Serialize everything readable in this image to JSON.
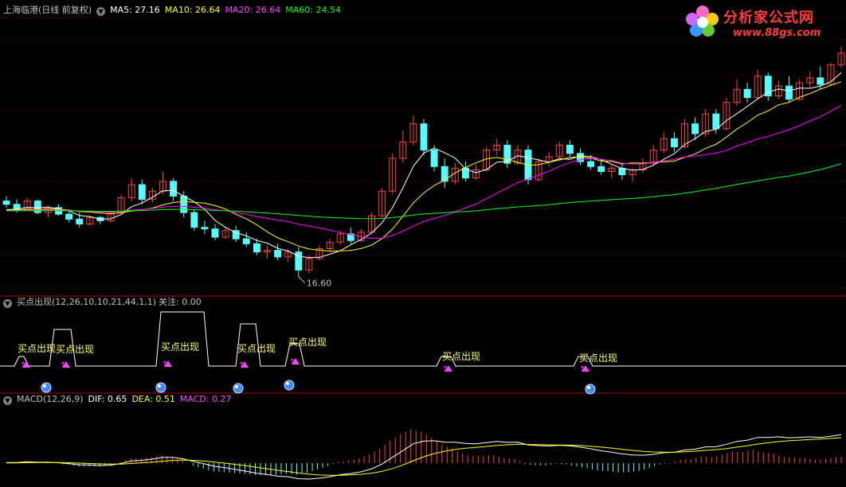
{
  "header": {
    "title": "上海临港(日线 前复权)",
    "ma5_label": "MA5: 27.16",
    "ma10_label": "MA10: 26.64",
    "ma20_label": "MA20: 26.64",
    "ma60_label": "MA60: 24.54"
  },
  "indicator_header": {
    "title": "买点出现(12,26,10,10,21,44,1,1)",
    "attention_label": "关注: 0.00"
  },
  "macd_header": {
    "title": "MACD(12,26,9)",
    "dif_label": "DIF: 0.65",
    "dea_label": "DEA: 0.51",
    "macd_label": "MACD: 0.27"
  },
  "logo": {
    "name": "分析家公式网",
    "url": "www.88gs.com"
  },
  "colors": {
    "up": "#ff4040",
    "down": "#54ffff",
    "ma5": "#ffffff",
    "ma10": "#ffff00",
    "ma20": "#ff00ff",
    "ma60": "#00ff00",
    "grid": "#80001a",
    "signal": "#ffff66"
  },
  "chart_data": [
    {
      "type": "candlestick",
      "title": "上海临港(日线 前复权)",
      "low_annotation": "16.60",
      "series": [
        {
          "name": "MA5",
          "value": 27.16
        },
        {
          "name": "MA10",
          "value": 26.64
        },
        {
          "name": "MA20",
          "value": 26.64
        },
        {
          "name": "MA60",
          "value": 24.54
        }
      ],
      "candles": [
        [
          21.2,
          21.5,
          20.8,
          21.0
        ],
        [
          21.0,
          21.3,
          20.5,
          20.7
        ],
        [
          20.7,
          21.4,
          20.6,
          21.2
        ],
        [
          21.2,
          21.3,
          20.4,
          20.5
        ],
        [
          20.5,
          20.9,
          20.2,
          20.8
        ],
        [
          20.8,
          21.0,
          20.3,
          20.4
        ],
        [
          20.4,
          20.6,
          19.9,
          20.1
        ],
        [
          20.1,
          20.5,
          19.6,
          19.8
        ],
        [
          19.8,
          20.3,
          19.7,
          20.2
        ],
        [
          20.2,
          20.3,
          19.8,
          20.0
        ],
        [
          20.0,
          20.6,
          19.9,
          20.5
        ],
        [
          20.5,
          21.6,
          20.4,
          21.4
        ],
        [
          21.4,
          22.6,
          21.2,
          22.2
        ],
        [
          22.2,
          22.5,
          21.0,
          21.3
        ],
        [
          21.3,
          22.0,
          21.1,
          21.8
        ],
        [
          21.8,
          23.0,
          21.6,
          22.4
        ],
        [
          22.4,
          22.6,
          21.2,
          21.5
        ],
        [
          21.5,
          21.8,
          20.2,
          20.5
        ],
        [
          20.5,
          20.7,
          19.4,
          19.6
        ],
        [
          19.6,
          20.0,
          19.2,
          19.5
        ],
        [
          19.5,
          19.8,
          18.8,
          19.0
        ],
        [
          19.0,
          19.6,
          18.9,
          19.4
        ],
        [
          19.4,
          19.7,
          18.7,
          18.9
        ],
        [
          18.9,
          19.3,
          18.4,
          18.6
        ],
        [
          18.6,
          18.9,
          17.9,
          18.1
        ],
        [
          18.1,
          18.5,
          17.7,
          18.2
        ],
        [
          18.2,
          18.6,
          17.6,
          17.8
        ],
        [
          17.8,
          18.3,
          17.5,
          18.1
        ],
        [
          18.1,
          18.4,
          16.6,
          17.0
        ],
        [
          17.0,
          17.9,
          16.8,
          17.7
        ],
        [
          17.7,
          18.5,
          17.6,
          18.3
        ],
        [
          18.3,
          18.9,
          18.1,
          18.7
        ],
        [
          18.7,
          19.4,
          18.5,
          19.2
        ],
        [
          19.2,
          19.6,
          18.6,
          18.8
        ],
        [
          18.8,
          19.5,
          18.7,
          19.3
        ],
        [
          19.3,
          20.5,
          19.2,
          20.3
        ],
        [
          20.3,
          22.0,
          20.2,
          21.8
        ],
        [
          21.8,
          24.1,
          21.6,
          23.8
        ],
        [
          23.8,
          25.5,
          23.5,
          24.8
        ],
        [
          24.8,
          26.4,
          24.6,
          25.9
        ],
        [
          25.9,
          26.2,
          24.0,
          24.3
        ],
        [
          24.3,
          24.6,
          23.0,
          23.3
        ],
        [
          23.3,
          23.8,
          22.0,
          22.4
        ],
        [
          22.4,
          23.5,
          22.2,
          23.2
        ],
        [
          23.2,
          23.6,
          22.4,
          22.6
        ],
        [
          22.6,
          23.4,
          22.5,
          23.1
        ],
        [
          23.1,
          24.5,
          23.0,
          24.3
        ],
        [
          24.3,
          25.0,
          24.0,
          24.6
        ],
        [
          24.6,
          24.9,
          23.2,
          23.5
        ],
        [
          23.5,
          24.6,
          23.4,
          24.3
        ],
        [
          24.3,
          24.6,
          22.2,
          22.5
        ],
        [
          22.5,
          23.8,
          22.4,
          23.6
        ],
        [
          23.6,
          24.2,
          23.3,
          23.9
        ],
        [
          23.9,
          24.8,
          23.7,
          24.6
        ],
        [
          24.6,
          24.9,
          23.9,
          24.1
        ],
        [
          24.1,
          24.4,
          23.4,
          23.6
        ],
        [
          23.6,
          24.0,
          23.1,
          23.3
        ],
        [
          23.3,
          23.7,
          22.8,
          23.0
        ],
        [
          23.0,
          23.4,
          22.6,
          23.2
        ],
        [
          23.2,
          23.5,
          22.5,
          22.8
        ],
        [
          22.8,
          23.2,
          22.4,
          23.1
        ],
        [
          23.1,
          23.8,
          22.9,
          23.5
        ],
        [
          23.5,
          24.6,
          23.4,
          24.3
        ],
        [
          24.3,
          25.4,
          24.1,
          25.0
        ],
        [
          25.0,
          25.4,
          24.2,
          24.5
        ],
        [
          24.5,
          26.2,
          24.4,
          25.9
        ],
        [
          25.9,
          26.3,
          24.9,
          25.3
        ],
        [
          25.3,
          26.8,
          25.1,
          26.5
        ],
        [
          26.5,
          26.8,
          25.3,
          25.6
        ],
        [
          25.6,
          27.5,
          25.5,
          27.2
        ],
        [
          27.2,
          28.6,
          27.0,
          28.0
        ],
        [
          28.0,
          28.4,
          27.2,
          27.5
        ],
        [
          27.5,
          29.2,
          27.4,
          28.8
        ],
        [
          28.8,
          29.0,
          27.3,
          27.6
        ],
        [
          27.6,
          28.5,
          27.4,
          28.2
        ],
        [
          28.2,
          28.8,
          27.2,
          27.4
        ],
        [
          27.4,
          28.6,
          27.3,
          28.4
        ],
        [
          28.4,
          29.1,
          28.1,
          28.7
        ],
        [
          28.7,
          29.4,
          28.0,
          28.3
        ],
        [
          28.3,
          29.6,
          28.2,
          29.5
        ],
        [
          29.5,
          30.6,
          29.3,
          30.2
        ]
      ]
    },
    {
      "type": "line",
      "title": "买点出现(12,26,10,10,21,44,1,1)",
      "attention": 0.0,
      "signal_labels": [
        "买点出现",
        "买点出现",
        "买点出现",
        "买点出现",
        "买点出现",
        "买点出现",
        "买点出现"
      ]
    },
    {
      "type": "bar",
      "title": "MACD(12,26,9)",
      "series": [
        {
          "name": "DIF",
          "value": 0.65
        },
        {
          "name": "DEA",
          "value": 0.51
        },
        {
          "name": "MACD",
          "value": 0.27
        }
      ]
    }
  ]
}
